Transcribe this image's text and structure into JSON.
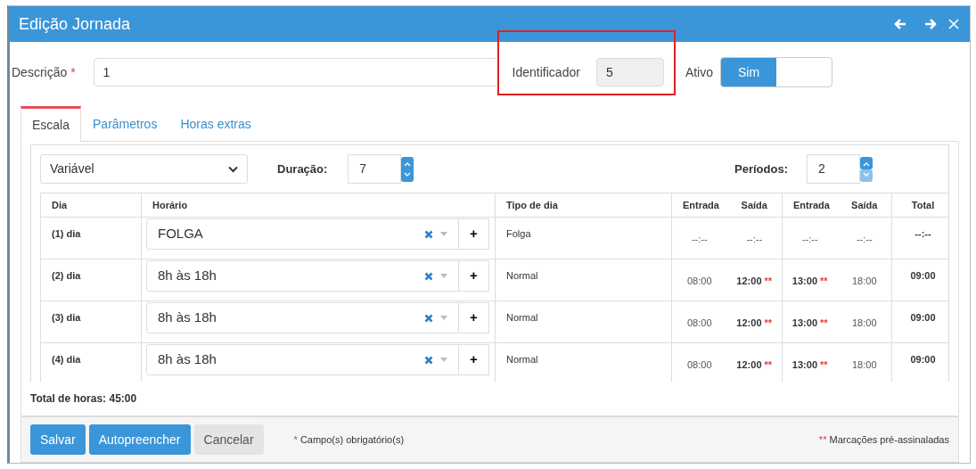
{
  "window": {
    "title": "Edição Jornada"
  },
  "form": {
    "description": {
      "label": "Descrição",
      "required_mark": "*",
      "value": "1"
    },
    "identifier": {
      "label": "Identificador",
      "value": "5",
      "highlighted": true
    },
    "active": {
      "label": "Ativo",
      "on_label": "Sim",
      "on": true
    }
  },
  "tabs": [
    {
      "label": "Escala",
      "selected": true
    },
    {
      "label": "Parâmetros",
      "selected": false
    },
    {
      "label": "Horas extras",
      "selected": false
    }
  ],
  "scale": {
    "type_select": {
      "value": "Variável"
    },
    "duration": {
      "label": "Duração:",
      "value": "7"
    },
    "periods": {
      "label": "Períodos:",
      "value": "2"
    },
    "columns": [
      "Dia",
      "Horário",
      "Tipo de dia",
      "Entrada",
      "Saída",
      "Entrada",
      "Saída",
      "Total"
    ],
    "rows": [
      {
        "day": "(1) dia",
        "schedule": "FOLGA",
        "add_label": "+",
        "day_type": "Folga",
        "times": [
          {
            "value": "--:--",
            "pre_signed": false
          },
          {
            "value": "--:--",
            "pre_signed": false
          },
          {
            "value": "--:--",
            "pre_signed": false
          },
          {
            "value": "--:--",
            "pre_signed": false
          }
        ],
        "total": "--:--"
      },
      {
        "day": "(2) dia",
        "schedule": "8h às 18h",
        "add_label": "+",
        "day_type": "Normal",
        "times": [
          {
            "value": "08:00",
            "pre_signed": false
          },
          {
            "value": "12:00",
            "pre_signed": true,
            "mark": "**"
          },
          {
            "value": "13:00",
            "pre_signed": true,
            "mark": "**"
          },
          {
            "value": "18:00",
            "pre_signed": false
          }
        ],
        "total": "09:00"
      },
      {
        "day": "(3) dia",
        "schedule": "8h às 18h",
        "add_label": "+",
        "day_type": "Normal",
        "times": [
          {
            "value": "08:00",
            "pre_signed": false
          },
          {
            "value": "12:00",
            "pre_signed": true,
            "mark": "**"
          },
          {
            "value": "13:00",
            "pre_signed": true,
            "mark": "**"
          },
          {
            "value": "18:00",
            "pre_signed": false
          }
        ],
        "total": "09:00"
      },
      {
        "day": "(4) dia",
        "schedule": "8h às 18h",
        "add_label": "+",
        "day_type": "Normal",
        "times": [
          {
            "value": "08:00",
            "pre_signed": false
          },
          {
            "value": "12:00",
            "pre_signed": true,
            "mark": "**"
          },
          {
            "value": "13:00",
            "pre_signed": true,
            "mark": "**"
          },
          {
            "value": "18:00",
            "pre_signed": false
          }
        ],
        "total": "09:00"
      }
    ],
    "total_hours": "Total de horas: 45:00"
  },
  "footer": {
    "buttons": [
      {
        "label": "Salvar",
        "kind": "primary"
      },
      {
        "label": "Autopreencher",
        "kind": "primary"
      },
      {
        "label": "Cancelar",
        "kind": "secondary"
      }
    ],
    "required_note": {
      "mark": "*",
      "text": "Campo(s) obrigatório(s)"
    },
    "presigned_note": {
      "mark": "**",
      "text": "Marcações pré-assinaladas"
    }
  }
}
